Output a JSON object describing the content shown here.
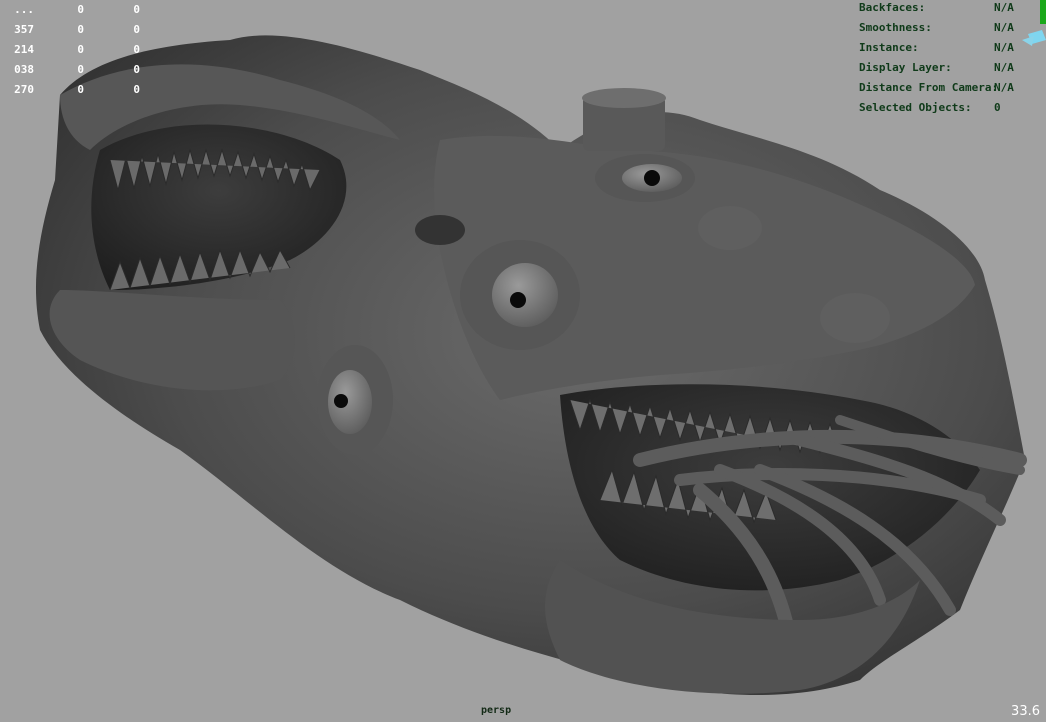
{
  "viewport": {
    "camera_label": "persp",
    "fps": "33.6"
  },
  "poly_count": {
    "rows": [
      {
        "c1": "...",
        "c2": "0",
        "c3": "0"
      },
      {
        "c1": "357",
        "c2": "0",
        "c3": "0"
      },
      {
        "c1": "214",
        "c2": "0",
        "c3": "0"
      },
      {
        "c1": "038",
        "c2": "0",
        "c3": "0"
      },
      {
        "c1": "270",
        "c2": "0",
        "c3": "0"
      }
    ]
  },
  "object_details": {
    "rows": [
      {
        "label": "Backfaces:",
        "value": "N/A"
      },
      {
        "label": "Smoothness:",
        "value": "N/A"
      },
      {
        "label": "Instance:",
        "value": "N/A"
      },
      {
        "label": "Display Layer:",
        "value": "N/A"
      },
      {
        "label": "Distance From Camera:",
        "value": "N/A"
      },
      {
        "label": "Selected Objects:",
        "value": "0"
      }
    ]
  },
  "colors": {
    "viewport_bg": "#a1a1a1",
    "model": "#4a4a4a",
    "hud_green": "#0f3a19"
  },
  "icons": {
    "gizmo": "axis-gizmo-icon"
  }
}
